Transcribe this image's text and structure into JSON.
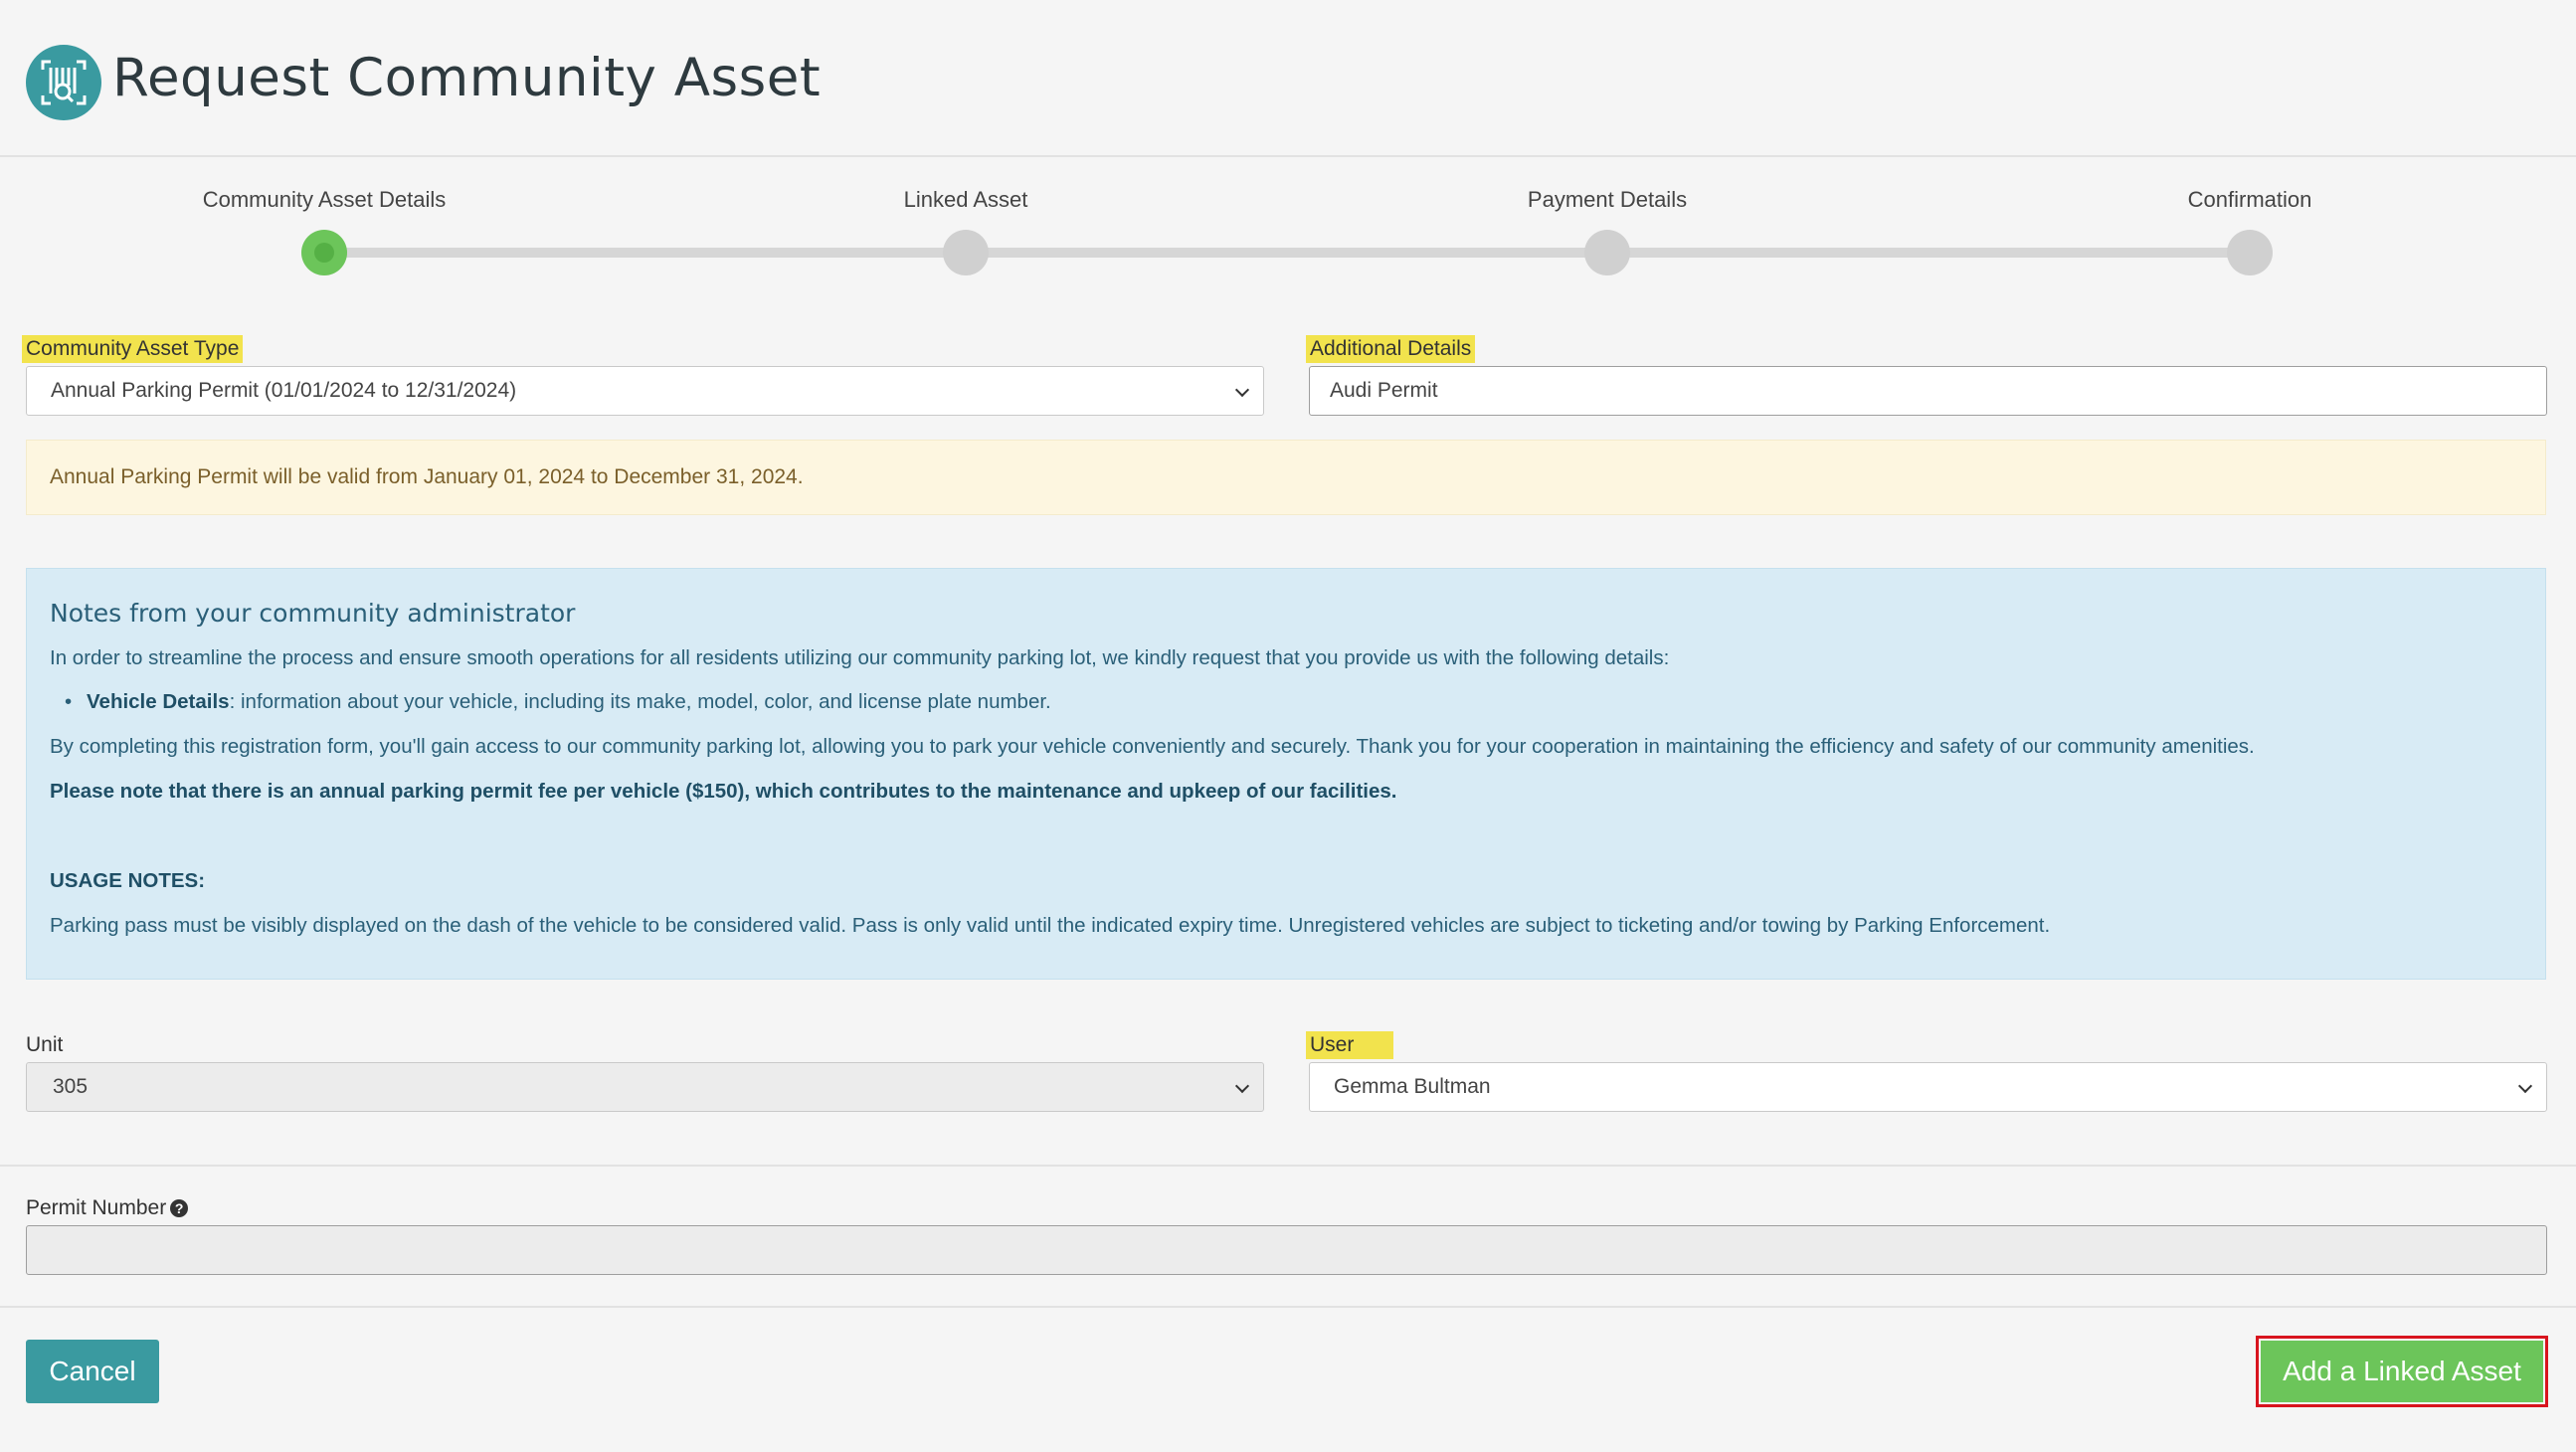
{
  "page": {
    "title": "Request Community Asset",
    "logo_icon": "parking-scan-icon"
  },
  "steps": [
    {
      "label": "Community Asset Details",
      "active": true
    },
    {
      "label": "Linked Asset",
      "active": false
    },
    {
      "label": "Payment Details",
      "active": false
    },
    {
      "label": "Confirmation",
      "active": false
    }
  ],
  "form": {
    "asset_type_label": "Community Asset Type",
    "asset_type_value": "Annual Parking Permit (01/01/2024 to 12/31/2024)",
    "additional_details_label": "Additional Details",
    "additional_details_value": "Audi Permit",
    "unit_label": "Unit",
    "unit_value": "305",
    "user_label": "User",
    "user_value": "Gemma Bultman",
    "permit_number_label": "Permit Number",
    "permit_number_value": ""
  },
  "validity_notice": "Annual Parking Permit will be valid from January 01, 2024 to December 31, 2024.",
  "notes": {
    "title": "Notes from your community administrator",
    "intro": "In order to streamline the process and ensure smooth operations for all residents utilizing our community parking lot, we kindly request that you provide us with the following details:",
    "bullet_bold": "Vehicle Details",
    "bullet_text": ": information about your vehicle, including its make, model, color, and license plate number.",
    "paragraph": "By completing this registration form, you'll gain access to our community parking lot, allowing you to park your vehicle conveniently and securely. Thank you for your cooperation in maintaining the efficiency and safety of our community amenities.",
    "fee_note": "Please note that there is an annual parking permit fee per vehicle ($150), which contributes to the maintenance and upkeep of our facilities.",
    "usage_heading": "USAGE NOTES:",
    "usage_text": "Parking pass must be visibly displayed on the dash of the vehicle to be considered valid. Pass is only valid until the indicated expiry time. Unregistered vehicles are subject to ticketing and/or towing by Parking Enforcement."
  },
  "actions": {
    "cancel_label": "Cancel",
    "add_linked_label": "Add a Linked Asset"
  },
  "colors": {
    "brand_teal": "#3a9aa0",
    "success_green": "#6cc55a",
    "highlight_yellow": "#f2e34d",
    "focus_red": "#d8141e"
  }
}
